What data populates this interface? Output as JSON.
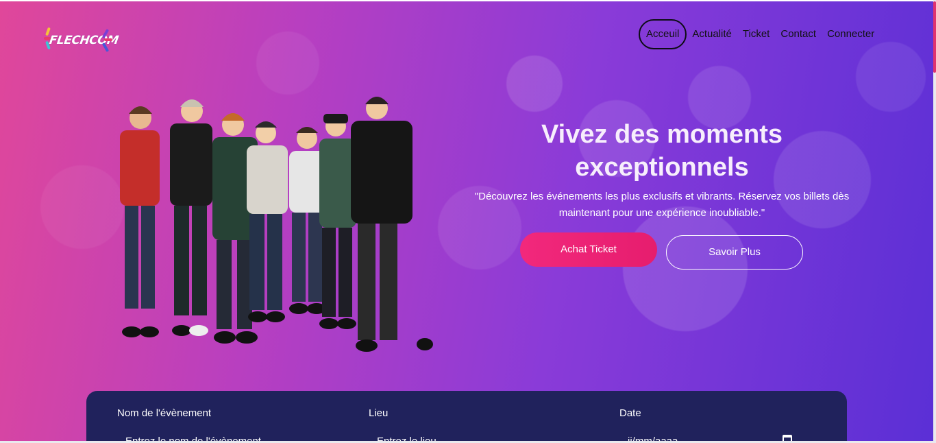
{
  "brand": {
    "name": "FLECHCOM"
  },
  "nav": {
    "items": [
      {
        "label": "Acceuil",
        "active": true
      },
      {
        "label": "Actualité"
      },
      {
        "label": "Ticket"
      },
      {
        "label": "Contact"
      },
      {
        "label": "Connecter"
      }
    ]
  },
  "hero": {
    "title": "Vivez des moments exceptionnels",
    "subtitle": "\"Découvrez les événements les plus exclusifs et vibrants. Réservez vos billets dès maintenant pour une expérience inoubliable.\"",
    "primary_button": "Achat Ticket",
    "secondary_button": "Savoir Plus"
  },
  "search": {
    "event_label": "Nom de l'évènement",
    "event_placeholder": "Entrez le nom de l'évènement",
    "place_label": "Lieu",
    "place_placeholder": "Entrez le lieu",
    "date_label": "Date",
    "date_placeholder": "jj/mm/aaaa"
  },
  "colors": {
    "accent": "#f2287c",
    "panel": "#20225c",
    "gradient_start": "#e0479a",
    "gradient_end": "#5b2fd6"
  }
}
